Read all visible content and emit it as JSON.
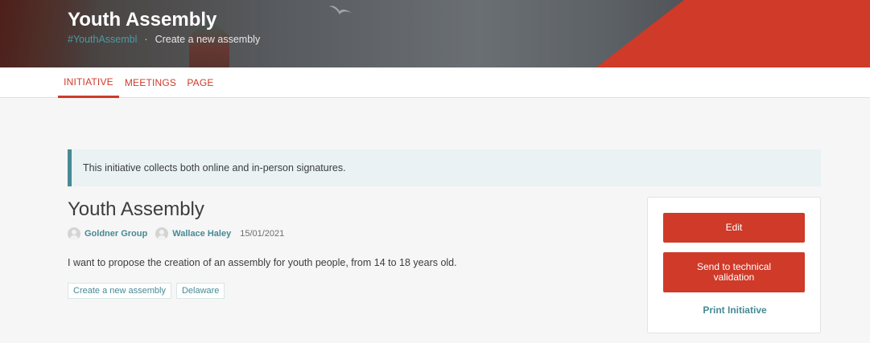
{
  "header": {
    "title": "Youth Assembly",
    "hashtag": "#YouthAssembl",
    "separator": "·",
    "subtitle_link": "Create a new assembly"
  },
  "tabs": [
    {
      "label": "INITIATIVE",
      "active": true
    },
    {
      "label": "MEETINGS",
      "active": false
    },
    {
      "label": "PAGE",
      "active": false
    }
  ],
  "callout": {
    "text": "This initiative collects both online and in-person signatures."
  },
  "initiative": {
    "title": "Youth Assembly",
    "authors": [
      {
        "name": "Goldner Group"
      },
      {
        "name": "Wallace Haley"
      }
    ],
    "date": "15/01/2021",
    "body": "I want to propose the creation of an assembly for youth people, from 14 to 18 years old.",
    "tags": [
      "Create a new assembly",
      "Delaware"
    ]
  },
  "sidebar": {
    "edit_label": "Edit",
    "send_label": "Send to technical validation",
    "print_label": "Print Initiative"
  },
  "colors": {
    "accent": "#cf3a29",
    "secondary": "#478a94",
    "callout_bg": "#eaf2f3"
  }
}
